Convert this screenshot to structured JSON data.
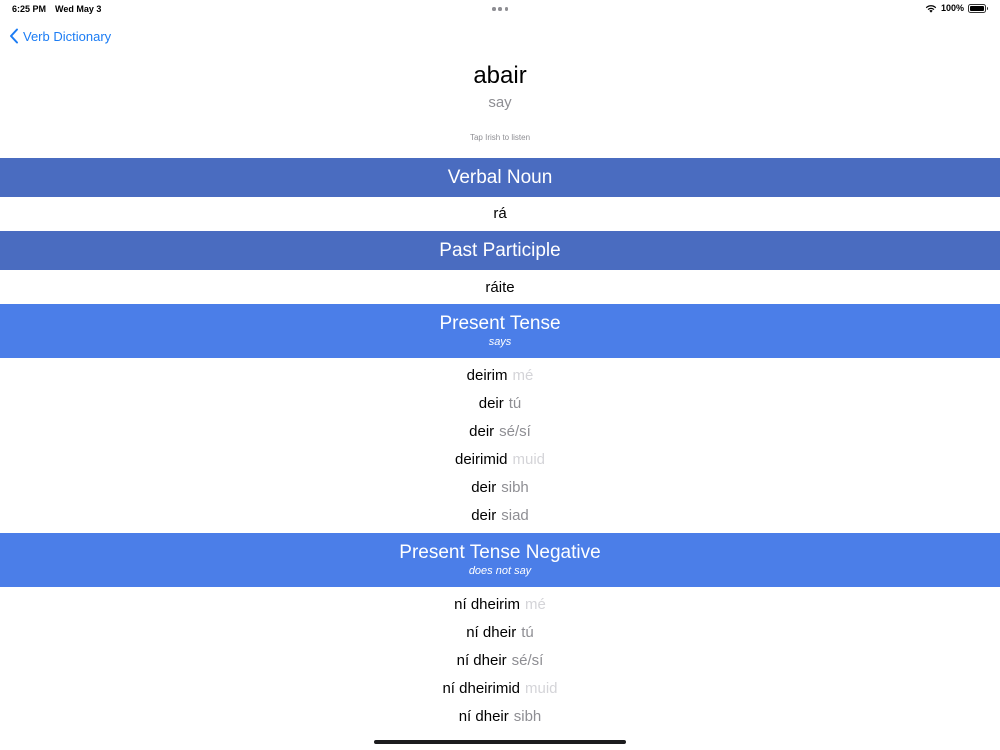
{
  "status_bar": {
    "time": "6:25 PM",
    "date": "Wed May 3",
    "battery_text": "100%",
    "battery_level": 1.0
  },
  "nav": {
    "back_label": "Verb Dictionary"
  },
  "verb": {
    "irish": "abair",
    "english": "say",
    "hint": "Tap Irish to listen"
  },
  "sections": {
    "verbal_noun": {
      "title": "Verbal Noun",
      "value": "rá"
    },
    "past_participle": {
      "title": "Past Participle",
      "value": "ráite"
    },
    "present": {
      "title": "Present Tense",
      "subtitle": "says",
      "forms": [
        {
          "verb": "deirim",
          "pronoun": "mé"
        },
        {
          "verb": "deir",
          "pronoun": "tú"
        },
        {
          "verb": "deir",
          "pronoun": "sé/sí"
        },
        {
          "verb": "deirimid",
          "pronoun": "muid"
        },
        {
          "verb": "deir",
          "pronoun": "sibh"
        },
        {
          "verb": "deir",
          "pronoun": "siad"
        }
      ]
    },
    "present_negative": {
      "title": "Present Tense Negative",
      "subtitle": "does not say",
      "forms": [
        {
          "verb": "ní dheirim",
          "pronoun": "mé"
        },
        {
          "verb": "ní dheir",
          "pronoun": "tú"
        },
        {
          "verb": "ní dheir",
          "pronoun": "sé/sí"
        },
        {
          "verb": "ní dheirimid",
          "pronoun": "muid"
        },
        {
          "verb": "ní dheir",
          "pronoun": "sibh"
        }
      ]
    }
  },
  "colors": {
    "accent": "#1b7cf4",
    "header_dark": "#4a6cc0",
    "header_light": "#4b7ee8",
    "secondary_text": "#8e8e93"
  }
}
